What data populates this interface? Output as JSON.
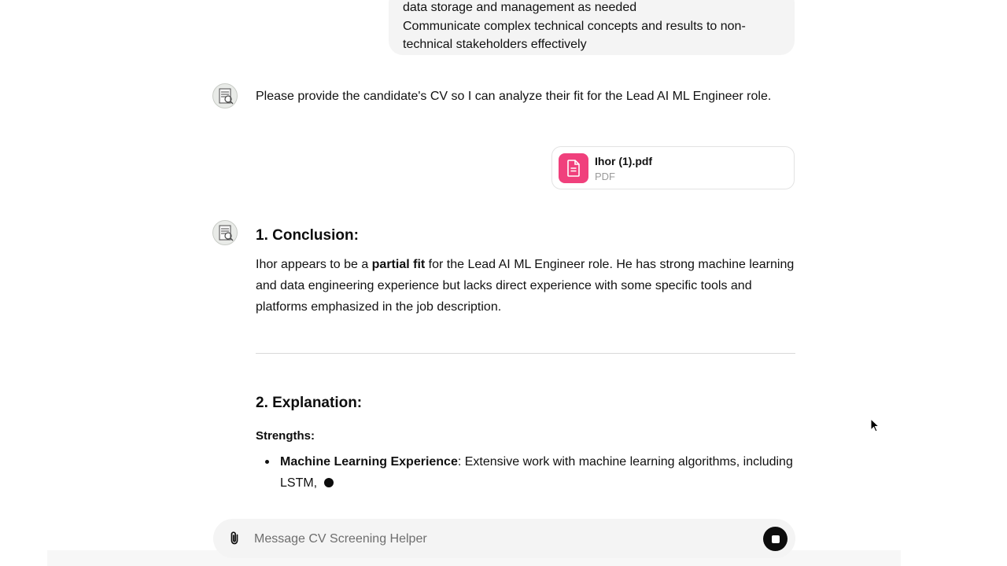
{
  "messages": {
    "user_tail": {
      "lines": [
        "data storage and management as needed",
        "Communicate complex technical concepts and results to non-",
        "technical stakeholders effectively"
      ]
    },
    "assistant_1": {
      "text": "Please provide the candidate's CV so I can analyze their fit for the Lead AI ML Engineer role."
    },
    "attachment": {
      "name": "Ihor (1).pdf",
      "type": "PDF",
      "icon": "document-icon",
      "color": "#f0407c"
    },
    "assistant_2": {
      "conclusion_heading": "1. Conclusion:",
      "conclusion_pre": "Ihor appears to be a ",
      "conclusion_bold": "partial fit",
      "conclusion_post": " for the Lead AI ML Engineer role. He has strong machine learning and data engineering experience but lacks direct experience with some specific tools and platforms emphasized in the job description.",
      "explanation_heading": "2. Explanation:",
      "strengths_label": "Strengths:",
      "strengths": [
        {
          "title": "Machine Learning Experience",
          "text": ": Extensive work with machine learning algorithms, including LSTM,"
        }
      ]
    }
  },
  "composer": {
    "placeholder": "Message CV Screening Helper",
    "attach_icon": "paperclip-icon",
    "stop_icon": "stop-icon"
  }
}
